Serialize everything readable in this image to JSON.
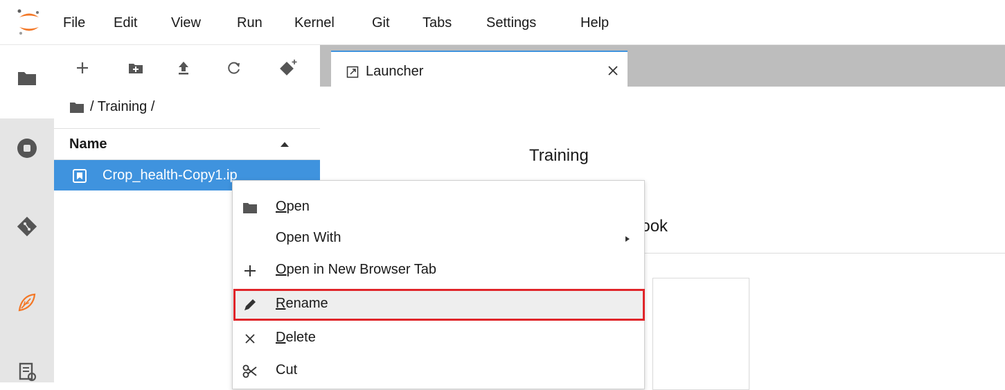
{
  "menubar": {
    "items": [
      "File",
      "Edit",
      "View",
      "Run",
      "Kernel",
      "Git",
      "Tabs",
      "Settings",
      "Help"
    ]
  },
  "filebrowser": {
    "breadcrumb": "/ Training /",
    "column_header": "Name",
    "rows": [
      {
        "name": "Crop_health-Copy1.ip",
        "selected": true
      }
    ]
  },
  "dock": {
    "tab_label": "Launcher"
  },
  "launcher": {
    "section_title": "Training",
    "subsection_partial": "book"
  },
  "context_menu": {
    "items": [
      {
        "label": "Open",
        "underline": "O",
        "icon": "folder-icon"
      },
      {
        "label": "Open With",
        "underline": "",
        "icon": "",
        "submenu": true
      },
      {
        "label": "Open in New Browser Tab",
        "underline": "O",
        "icon": "plus-icon"
      },
      {
        "label": "Rename",
        "underline": "R",
        "icon": "pencil-icon",
        "highlighted": true
      },
      {
        "label": "Delete",
        "underline": "D",
        "icon": "close-icon"
      },
      {
        "label": "Cut",
        "underline": "",
        "icon": "scissors-icon"
      }
    ]
  },
  "colors": {
    "accent": "#3f93de",
    "highlight_border": "#e0252a",
    "activity_bar": "#e5e5e5",
    "tab_bar": "#bdbdbd"
  }
}
